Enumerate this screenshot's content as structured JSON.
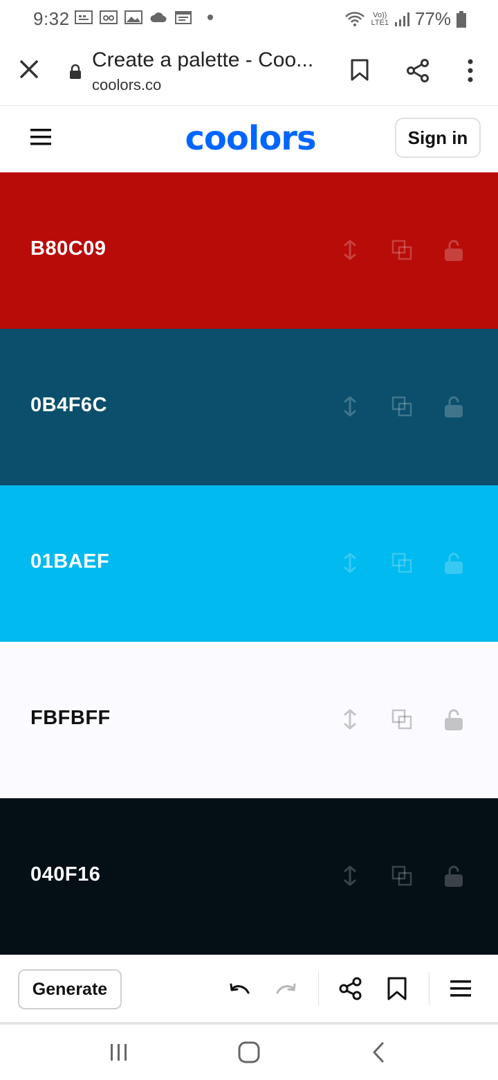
{
  "status_bar": {
    "time": "9:32",
    "network_label_top": "Vo))",
    "network_label_bottom": "LTE1",
    "battery": "77%"
  },
  "browser": {
    "page_title": "Create a palette - Coo...",
    "url": "coolors.co"
  },
  "site": {
    "logo_text": "coolors",
    "brand_color": "#0066ff",
    "sign_in_label": "Sign in"
  },
  "palette": [
    {
      "hex": "B80C09",
      "color": "#B80C09",
      "text_color": "#ffffff"
    },
    {
      "hex": "0B4F6C",
      "color": "#0B4F6C",
      "text_color": "#ffffff"
    },
    {
      "hex": "01BAEF",
      "color": "#01BAEF",
      "text_color": "#ffffff"
    },
    {
      "hex": "FBFBFF",
      "color": "#FBFBFF",
      "text_color": "#111111"
    },
    {
      "hex": "040F16",
      "color": "#040F16",
      "text_color": "#ffffff"
    }
  ],
  "toolbar": {
    "generate_label": "Generate"
  }
}
